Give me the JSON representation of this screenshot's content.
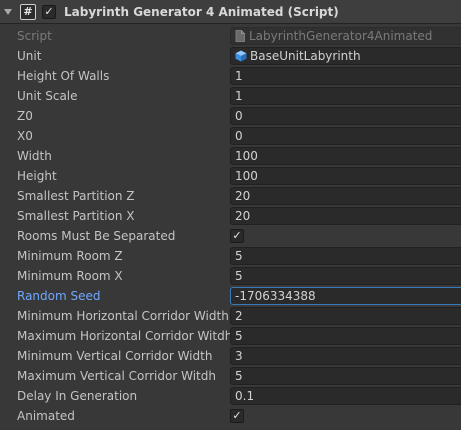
{
  "header": {
    "title": "Labyrinth Generator 4 Animated (Script)",
    "script_icon_glyph": "#",
    "enabled_check": "✓"
  },
  "fields": [
    {
      "label": "Script",
      "value": "LabyrinthGenerator4Animated",
      "kind": "objref-dim",
      "icon": "script-file-icon"
    },
    {
      "label": "Unit",
      "value": "BaseUnitLabyrinth",
      "kind": "objref",
      "icon": "prefab-cube-icon"
    },
    {
      "label": "Height Of Walls",
      "value": "1",
      "kind": "number"
    },
    {
      "label": "Unit Scale",
      "value": "1",
      "kind": "number"
    },
    {
      "label": "Z0",
      "value": "0",
      "kind": "number"
    },
    {
      "label": "X0",
      "value": "0",
      "kind": "number"
    },
    {
      "label": "Width",
      "value": "100",
      "kind": "number"
    },
    {
      "label": "Height",
      "value": "100",
      "kind": "number"
    },
    {
      "label": "Smallest Partition Z",
      "value": "20",
      "kind": "number"
    },
    {
      "label": "Smallest Partition X",
      "value": "20",
      "kind": "number"
    },
    {
      "label": "Rooms Must Be Separated",
      "value": "✓",
      "kind": "toggle",
      "checked": true
    },
    {
      "label": "Minimum Room Z",
      "value": "5",
      "kind": "number"
    },
    {
      "label": "Minimum Room X",
      "value": "5",
      "kind": "number"
    },
    {
      "label": "Random Seed",
      "value": "-1706334388",
      "kind": "number-active"
    },
    {
      "label": "Minimum Horizontal Corridor Width",
      "value": "2",
      "kind": "number"
    },
    {
      "label": "Maximum Horizontal Corridor Witdh",
      "value": "5",
      "kind": "number"
    },
    {
      "label": "Minimum Vertical Corridor Width",
      "value": "3",
      "kind": "number"
    },
    {
      "label": "Maximum Vertical Corridor Witdh",
      "value": "5",
      "kind": "number"
    },
    {
      "label": "Delay In Generation",
      "value": "0.1",
      "kind": "number"
    },
    {
      "label": "Animated",
      "value": "✓",
      "kind": "toggle",
      "checked": true
    }
  ],
  "colors": {
    "background": "#383838",
    "header": "#3e3e3e",
    "field": "#2a2a2a",
    "focus_label": "#6fa8ff",
    "focus_border": "#3a79bb"
  }
}
